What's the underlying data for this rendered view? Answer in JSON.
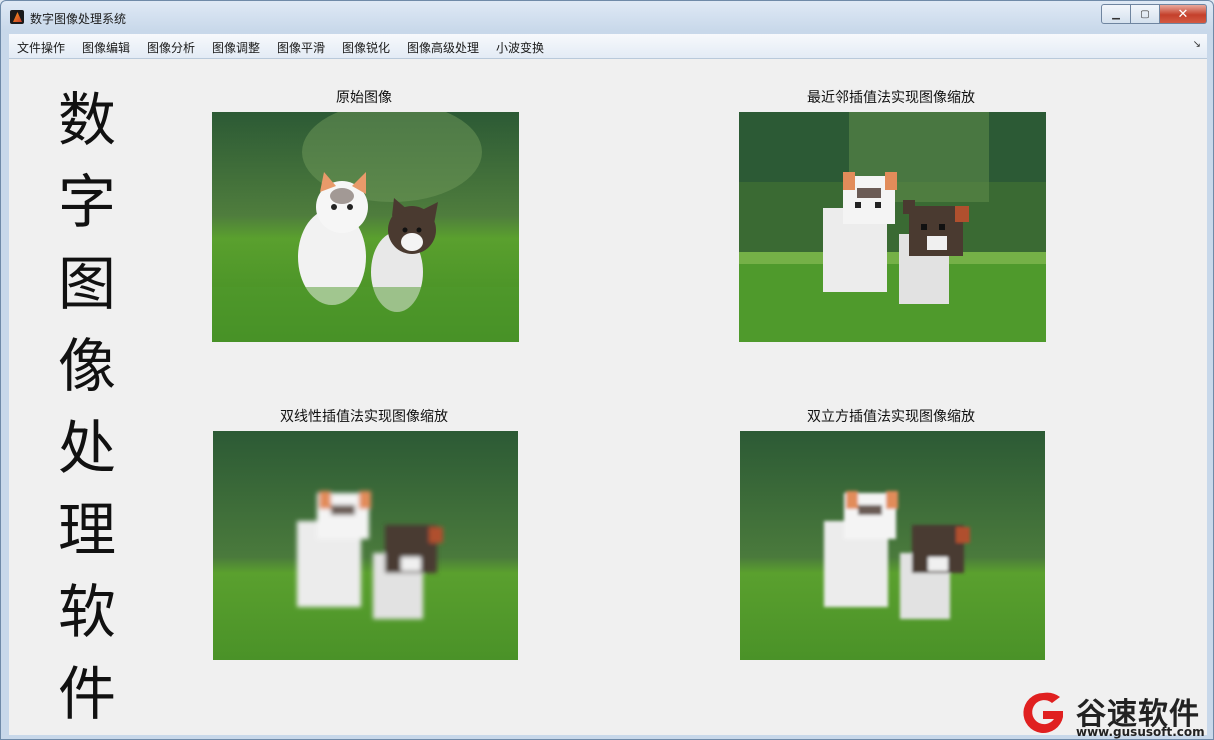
{
  "window": {
    "title": "数字图像处理系统",
    "controls": {
      "min": "▁",
      "max": "▢",
      "close": "✕"
    }
  },
  "menubar": {
    "items": [
      "文件操作",
      "图像编辑",
      "图像分析",
      "图像调整",
      "图像平滑",
      "图像锐化",
      "图像高级处理",
      "小波变换"
    ],
    "overflow_icon": "chevron-down-icon"
  },
  "side_title": [
    "数",
    "字",
    "图",
    "像",
    "处",
    "理",
    "软",
    "件"
  ],
  "panels": [
    {
      "title": "原始图像",
      "image": "kittens-on-grass"
    },
    {
      "title": "最近邻插值法实现图像缩放",
      "image": "kittens-on-grass-nearest"
    },
    {
      "title": "双线性插值法实现图像缩放",
      "image": "kittens-on-grass-bilinear"
    },
    {
      "title": "双立方插值法实现图像缩放",
      "image": "kittens-on-grass-bicubic"
    }
  ],
  "watermark": {
    "brand": "谷速软件",
    "url": "www.gususoft.com",
    "color": "#e02020"
  },
  "colors": {
    "background": "#f0f0f0",
    "grass": "#4f9a2c",
    "forest": "#2e5b2a"
  }
}
